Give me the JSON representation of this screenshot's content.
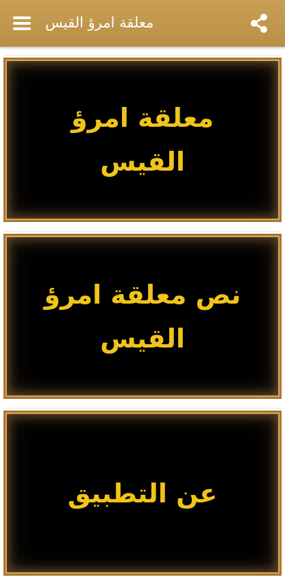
{
  "header": {
    "title": "معلقة امرؤ القيس",
    "menu_icon": "hamburger-menu-icon",
    "share_icon": "share-icon",
    "background": "#c19a50",
    "text_color": "#ffffff"
  },
  "cards": [
    {
      "label": "معلقة امرؤ القيس"
    },
    {
      "label": "نص معلقة امرؤ القيس"
    },
    {
      "label": "عن التطبيق"
    }
  ],
  "colors": {
    "card_background": "#000000",
    "card_text": "#f0c41a",
    "card_border": "#a87733"
  }
}
